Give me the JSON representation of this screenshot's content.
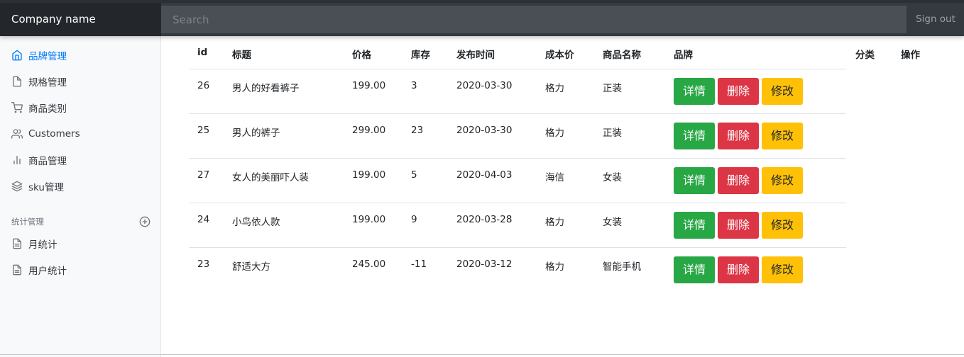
{
  "navbar": {
    "brand": "Company name",
    "search_placeholder": "Search",
    "signout_label": "Sign out"
  },
  "sidebar": {
    "items": [
      {
        "label": "品牌管理",
        "icon": "home-icon",
        "active": true
      },
      {
        "label": "规格管理",
        "icon": "file-icon",
        "active": false
      },
      {
        "label": "商品类别",
        "icon": "shopping-cart-icon",
        "active": false
      },
      {
        "label": "Customers",
        "icon": "users-icon",
        "active": false
      },
      {
        "label": "商品管理",
        "icon": "bar-chart-icon",
        "active": false
      },
      {
        "label": "sku管理",
        "icon": "layers-icon",
        "active": false
      }
    ],
    "section_title": "统计管理",
    "section_items": [
      {
        "label": "月统计",
        "icon": "file-text-icon"
      },
      {
        "label": "用户统计",
        "icon": "file-text-icon"
      }
    ]
  },
  "table": {
    "headers": [
      "id",
      "标题",
      "价格",
      "库存",
      "发布时间",
      "成本价",
      "商品名称",
      "品牌",
      "分类",
      "操作"
    ],
    "rows": [
      [
        "26",
        "男人的好看裤子",
        "199.00",
        "3",
        "2020-03-30",
        "格力",
        "正装"
      ],
      [
        "25",
        "男人的裤子",
        "299.00",
        "23",
        "2020-03-30",
        "格力",
        "正装"
      ],
      [
        "27",
        "女人的美丽吓人装",
        "199.00",
        "5",
        "2020-04-03",
        "海信",
        "女装"
      ],
      [
        "24",
        "小鸟依人款",
        "199.00",
        "9",
        "2020-03-28",
        "格力",
        "女装"
      ],
      [
        "23",
        "舒适大方",
        "245.00",
        "-11",
        "2020-03-12",
        "格力",
        "智能手机"
      ]
    ],
    "actions": {
      "detail": "详情",
      "delete": "删除",
      "edit": "修改"
    }
  },
  "colors": {
    "navbar": "#343a40",
    "active_link": "#007bff",
    "detail_button": "#28a745",
    "delete_button": "#dc3545",
    "edit_button": "#ffc107"
  }
}
